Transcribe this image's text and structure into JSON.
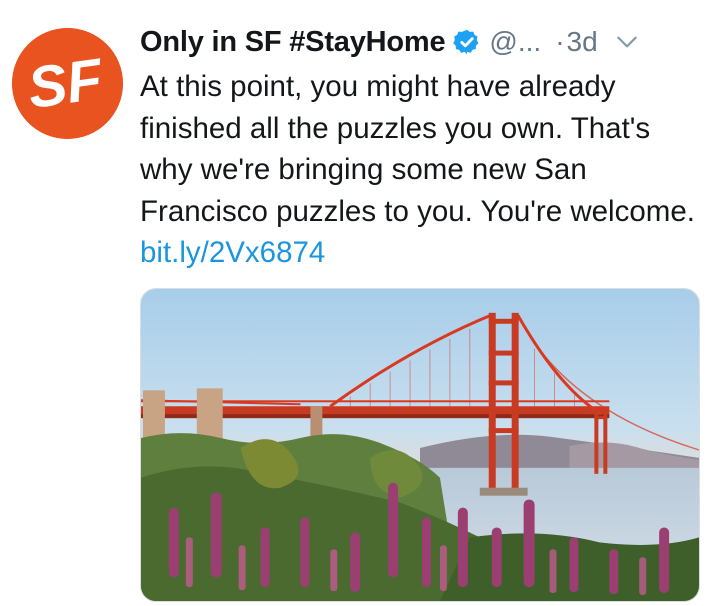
{
  "tweet": {
    "avatar_text": "SF",
    "display_name": "Only in SF #StayHome",
    "handle": "@...",
    "separator": "·",
    "time": "3d",
    "body": "At this point, you might have already finished all the puzzles you own. That's why we're bringing some new San Francisco puzzles to you. You're welcome.",
    "link_text": "bit.ly/2Vx6874"
  },
  "icons": {
    "verified": "verified-badge-icon",
    "more": "chevron-down-icon"
  },
  "colors": {
    "avatar": "#e8531f",
    "link": "#1b95e0",
    "verified": "#1da1f2",
    "muted": "#657786",
    "bridge": "#d9391f"
  }
}
